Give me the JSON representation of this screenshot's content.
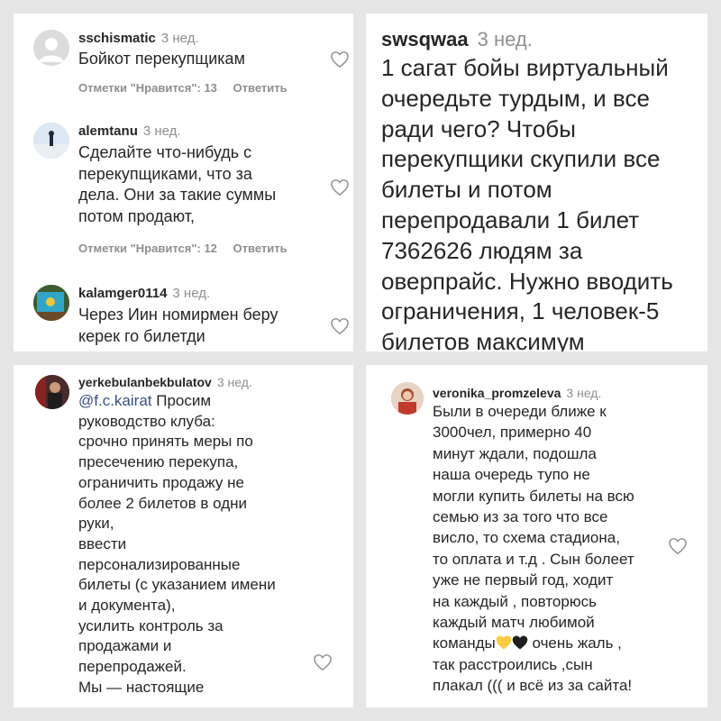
{
  "panel1": {
    "comments": [
      {
        "username": "sschismatic",
        "time": "3 нед.",
        "lines": [
          "Бойкот перекупщикам"
        ],
        "likes_label": "Отметки \"Нравится\": 13",
        "reply_label": "Ответить"
      },
      {
        "username": "alemtanu",
        "time": "3 нед.",
        "lines": [
          "Сделайте что-нибудь с",
          "перекупщиками, что за",
          "дела. Они за такие суммы",
          "потом продают,"
        ],
        "likes_label": "Отметки \"Нравится\": 12",
        "reply_label": "Ответить"
      },
      {
        "username": "kalamger0114",
        "time": "3 нед.",
        "lines": [
          "Через Иин номирмен беру",
          "керек го билетди"
        ]
      }
    ]
  },
  "panel2": {
    "username": "swsqwaa",
    "time": "3 нед.",
    "lines": [
      "1 сагат бойы виртуальный",
      "очередьте турдым, и все",
      "ради чего? Чтобы",
      "перекупщики скупили все",
      "билеты и потом",
      "перепродавали 1 билет",
      "7362626 людям за",
      "оверпрайс. Нужно вводить",
      "ограничения, 1 человек-5",
      "билетов максимум"
    ]
  },
  "panel3": {
    "username": "yerkebulanbekbulatov",
    "time": "3 нед.",
    "mention": "@f.c.kairat",
    "first_line_rest": " Просим",
    "lines": [
      "руководство клуба:",
      "срочно принять меры по",
      "пресечению перекупа,",
      "ограничить продажу не",
      "более 2 билетов в одни",
      "руки,",
      "ввести",
      "персонализированные",
      "билеты (с указанием имени",
      "и документа),",
      "усилить контроль за",
      "продажами и",
      "перепродажей.",
      "Мы — настоящие"
    ]
  },
  "panel4": {
    "username": "veronika_promzeleva",
    "time": "3 нед.",
    "lines": [
      "Были в очереди ближе к",
      "3000чел, примерно 40",
      "минут ждали, подошла",
      "наша очередь тупо не",
      "могли купить билеты на всю",
      "семью из за того что все",
      "висло, то схема стадиона,",
      "то оплата и т.д . Сын болеет",
      "уже не первый год, ходит",
      "на каждый , повторюсь",
      "каждый матч любимой"
    ],
    "emoji_line_start": "команды",
    "emoji_line_end": " очень жаль ,",
    "lines_after": [
      "так расстроились ,сын",
      "плакал ((( и всё из за сайта!"
    ],
    "emoji_names": [
      "yellow-heart-icon",
      "black-heart-icon"
    ]
  },
  "colors": {
    "text": "#262626",
    "secondary": "#8e8e8e",
    "mention": "#385185",
    "background": "#e6e6e6"
  }
}
